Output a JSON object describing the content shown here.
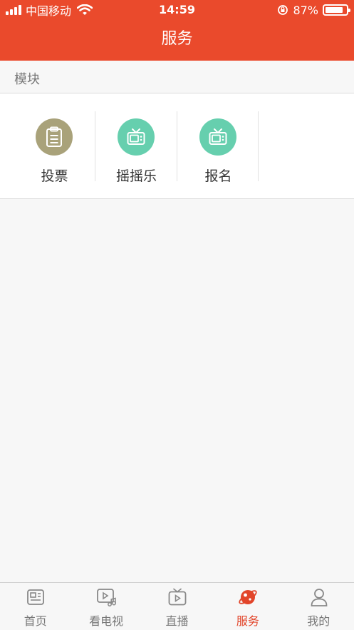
{
  "status_bar": {
    "carrier": "中国移动",
    "time": "14:59",
    "battery_percent": "87%",
    "battery_level": 0.87,
    "signal_icon": "signal-bars-icon",
    "wifi_icon": "wifi-icon",
    "orientation_lock_icon": "orientation-lock-icon"
  },
  "header": {
    "title": "服务"
  },
  "section": {
    "title": "模块"
  },
  "modules": [
    {
      "label": "投票",
      "icon": "clipboard-icon",
      "color": "#a9a27a"
    },
    {
      "label": "摇摇乐",
      "icon": "tv-icon",
      "color": "#66cfae"
    },
    {
      "label": "报名",
      "icon": "tv-icon",
      "color": "#66cfae"
    }
  ],
  "tabbar": {
    "tabs": [
      {
        "label": "首页",
        "icon": "news-icon",
        "active": false
      },
      {
        "label": "看电视",
        "icon": "video-music-icon",
        "active": false
      },
      {
        "label": "直播",
        "icon": "live-tv-icon",
        "active": false
      },
      {
        "label": "服务",
        "icon": "planet-icon",
        "active": true
      },
      {
        "label": "我的",
        "icon": "user-icon",
        "active": false
      }
    ]
  },
  "colors": {
    "accent": "#ea4a2c",
    "active_tab": "#e2452a",
    "inactive_tab": "#777777",
    "background": "#f7f7f7"
  }
}
